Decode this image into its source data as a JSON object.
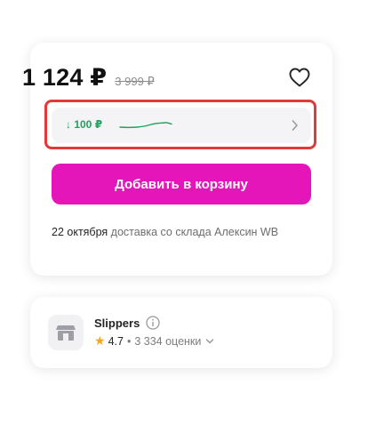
{
  "product": {
    "price_current": "1 124 ₽",
    "price_old": "3 999 ₽",
    "favorite_icon": "heart-outline-icon"
  },
  "price_history": {
    "label": "↓ 100 ₽",
    "accent_color": "#1da35a",
    "chevron_icon": "chevron-right-icon"
  },
  "cart_button": {
    "label": "Добавить в корзину",
    "color": "#e516b9"
  },
  "delivery": {
    "date": "22 октября",
    "text": "доставка со склада Алексин WB"
  },
  "seller": {
    "name": "Slippers",
    "rating": "4.7",
    "reviews": "3 334 оценки",
    "store_icon": "store-icon",
    "info_icon": "info-icon",
    "star_color": "#f5a623"
  },
  "highlight_color": "#e23a3a"
}
